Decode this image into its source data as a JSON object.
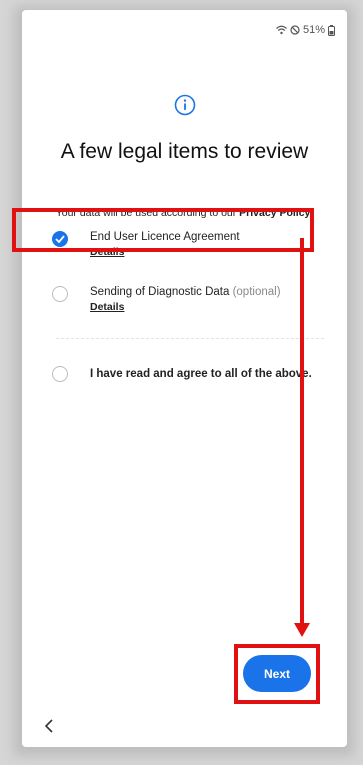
{
  "status_bar": {
    "battery": "51%"
  },
  "icons": {
    "wifi": "wifi-icon",
    "dnd": "do-not-disturb-icon",
    "battery": "battery-icon",
    "info": "info-icon",
    "check": "check-icon",
    "back": "chevron-left-icon"
  },
  "title": "A few legal items to review",
  "privacy": {
    "prefix": "Your data will be used according to our ",
    "link": "Privacy Policy",
    "suffix": "."
  },
  "items": [
    {
      "label": "End User Licence Agreement",
      "details": "Details",
      "checked": true
    },
    {
      "label": "Sending of Diagnostic Data",
      "optional": "(optional)",
      "details": "Details",
      "checked": false
    }
  ],
  "agree_all": {
    "label": "I have read and agree to all of the above.",
    "checked": false
  },
  "next_button": "Next",
  "colors": {
    "accent": "#1a73e8",
    "annotation": "#e11111"
  }
}
